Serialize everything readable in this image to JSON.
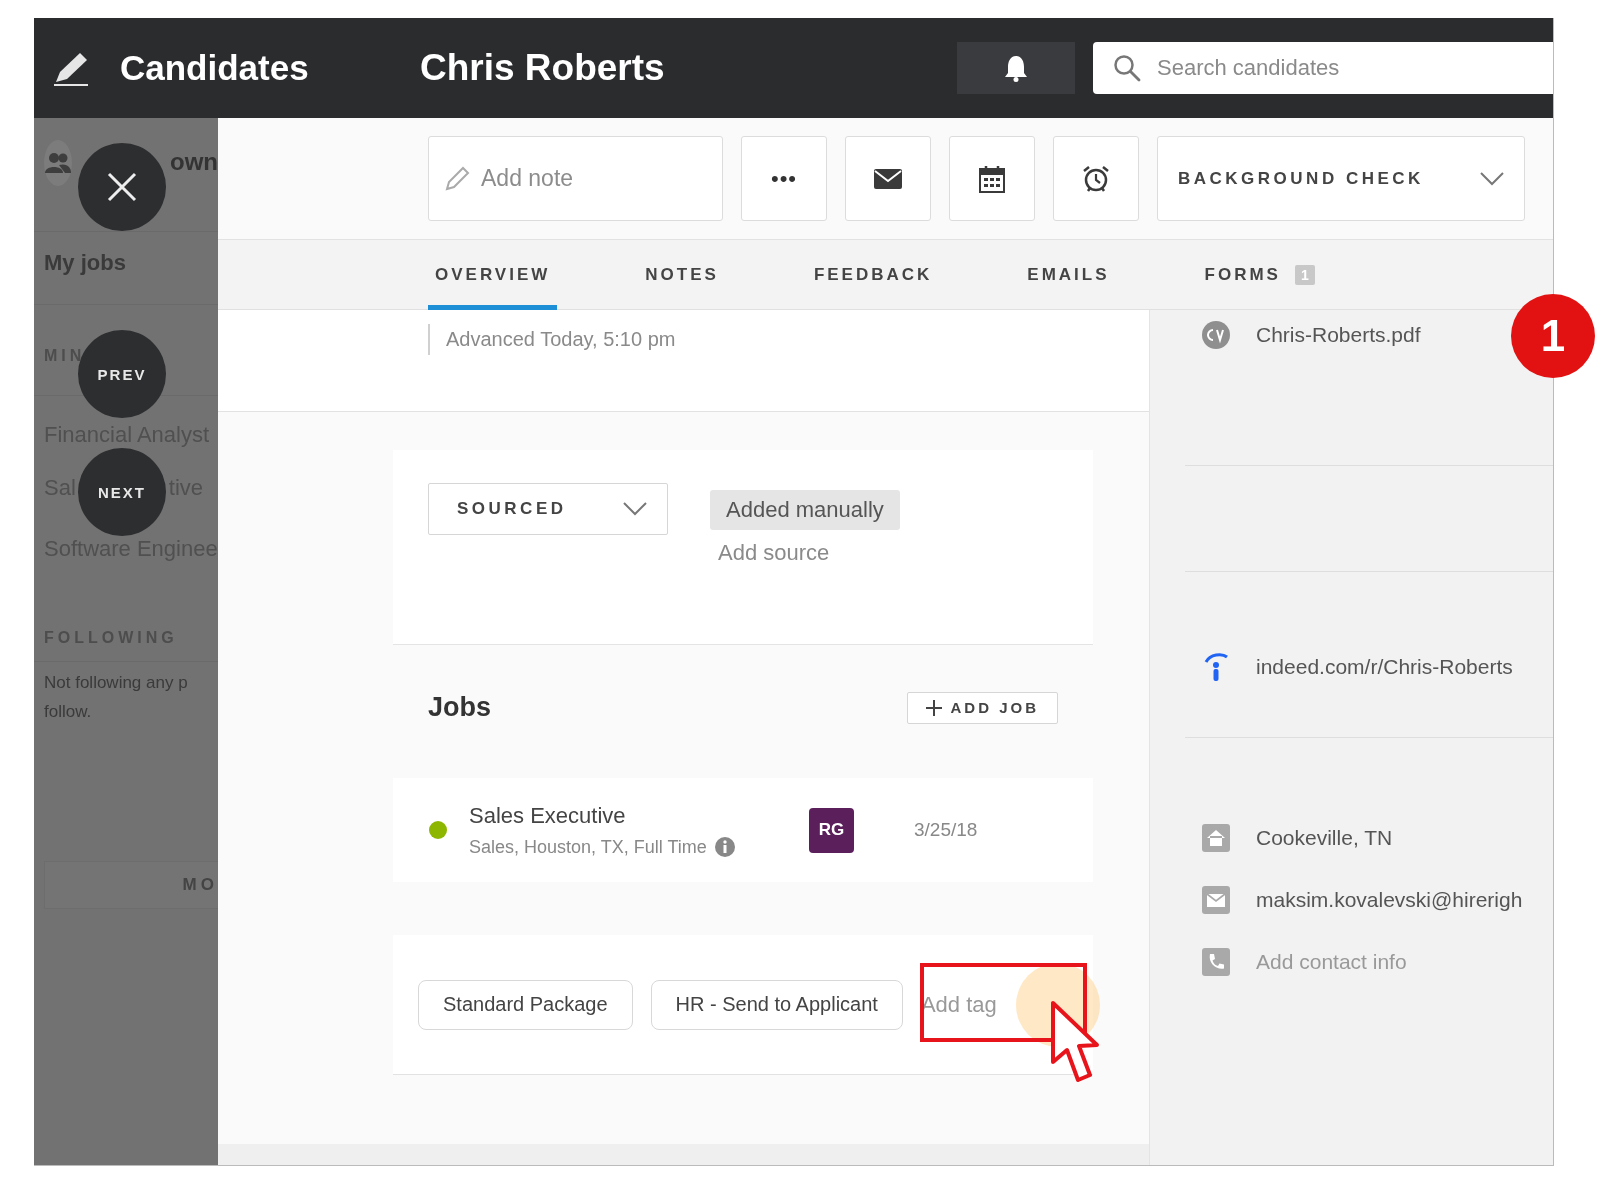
{
  "header": {
    "section": "Candidates",
    "candidate": "Chris Roberts",
    "search": {
      "placeholder": "Search candidates"
    }
  },
  "sidebar": {
    "owner_text": "own",
    "my_jobs": "My jobs",
    "section_label": "MIN",
    "jobs": [
      {
        "parts": [
          "Financial Analyst"
        ]
      },
      {
        "parts": [
          "Sal",
          "tive"
        ]
      },
      {
        "parts": [
          "Software Enginee"
        ]
      }
    ],
    "following_label": "FOLLOWING",
    "following_empty": "Not following any p follow.",
    "more_button": "MO"
  },
  "overlay_buttons": [
    {
      "kind": "close"
    },
    {
      "kind": "text",
      "label": "PREV"
    },
    {
      "kind": "text",
      "label": "NEXT"
    }
  ],
  "toolbar": {
    "note": {
      "placeholder": "Add note"
    },
    "more": "•••",
    "stage": "BACKGROUND CHECK"
  },
  "tabs": [
    {
      "label": "OVERVIEW",
      "selected": true
    },
    {
      "label": "NOTES",
      "selected": false
    },
    {
      "label": "FEEDBACK",
      "selected": false
    },
    {
      "label": "EMAILS",
      "selected": false
    },
    {
      "label": "FORMS",
      "selected": false,
      "badge": "1"
    }
  ],
  "activity": "Advanced Today, 5:10 pm",
  "source": {
    "stage": "SOURCED",
    "tag": "Added manually",
    "add": "Add source"
  },
  "jobs": {
    "title": "Jobs",
    "add_button": "ADD JOB",
    "items": [
      {
        "title": "Sales Executive",
        "details": "Sales, Houston, TX, Full Time",
        "color": "#8db600",
        "recruiter": "RG",
        "date": "3/25/18"
      }
    ]
  },
  "tags": {
    "items": [
      "Standard Package",
      "HR - Send to Applicant"
    ],
    "add": "Add tag"
  },
  "profile": {
    "files": [
      {
        "kind": "cv",
        "label": "Chris-Roberts.pdf"
      }
    ],
    "links": [
      {
        "kind": "indeed",
        "label": "indeed.com/r/Chris-Roberts"
      }
    ],
    "contact": [
      {
        "kind": "location",
        "label": "Cookeville, TN",
        "empty": false
      },
      {
        "kind": "email",
        "label": "maksim.kovalevski@hirerigh",
        "empty": false
      },
      {
        "kind": "phone",
        "label": "Add contact info",
        "empty": true
      }
    ]
  },
  "step_marker": "1"
}
